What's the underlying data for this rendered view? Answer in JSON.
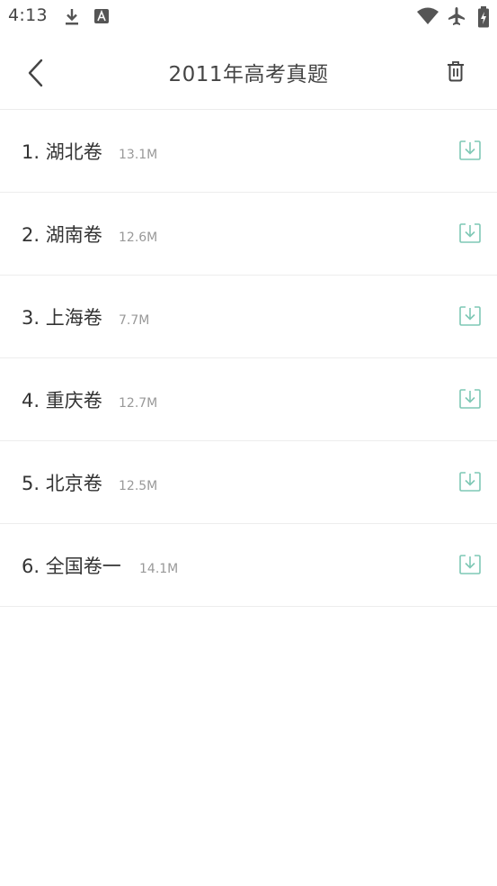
{
  "status_bar": {
    "time": "4:13",
    "icons": [
      "download-icon",
      "font-a-icon",
      "wifi-icon",
      "airplane-icon",
      "battery-charging-icon"
    ]
  },
  "header": {
    "back_icon": "chevron-left-icon",
    "title": "2011年高考真题",
    "delete_icon": "trash-icon"
  },
  "colors": {
    "download_accent": "#7fc8b5",
    "divider": "#ececec",
    "title_text": "#444444",
    "size_text": "#999999"
  },
  "items": [
    {
      "index": "1.",
      "name": "湖北卷",
      "size": "13.1M"
    },
    {
      "index": "2.",
      "name": "湖南卷",
      "size": "12.6M"
    },
    {
      "index": "3.",
      "name": "上海卷",
      "size": "7.7M"
    },
    {
      "index": "4.",
      "name": "重庆卷",
      "size": "12.7M"
    },
    {
      "index": "5.",
      "name": "北京卷",
      "size": "12.5M"
    },
    {
      "index": "6.",
      "name": "全国卷一",
      "size": "14.1M"
    }
  ]
}
